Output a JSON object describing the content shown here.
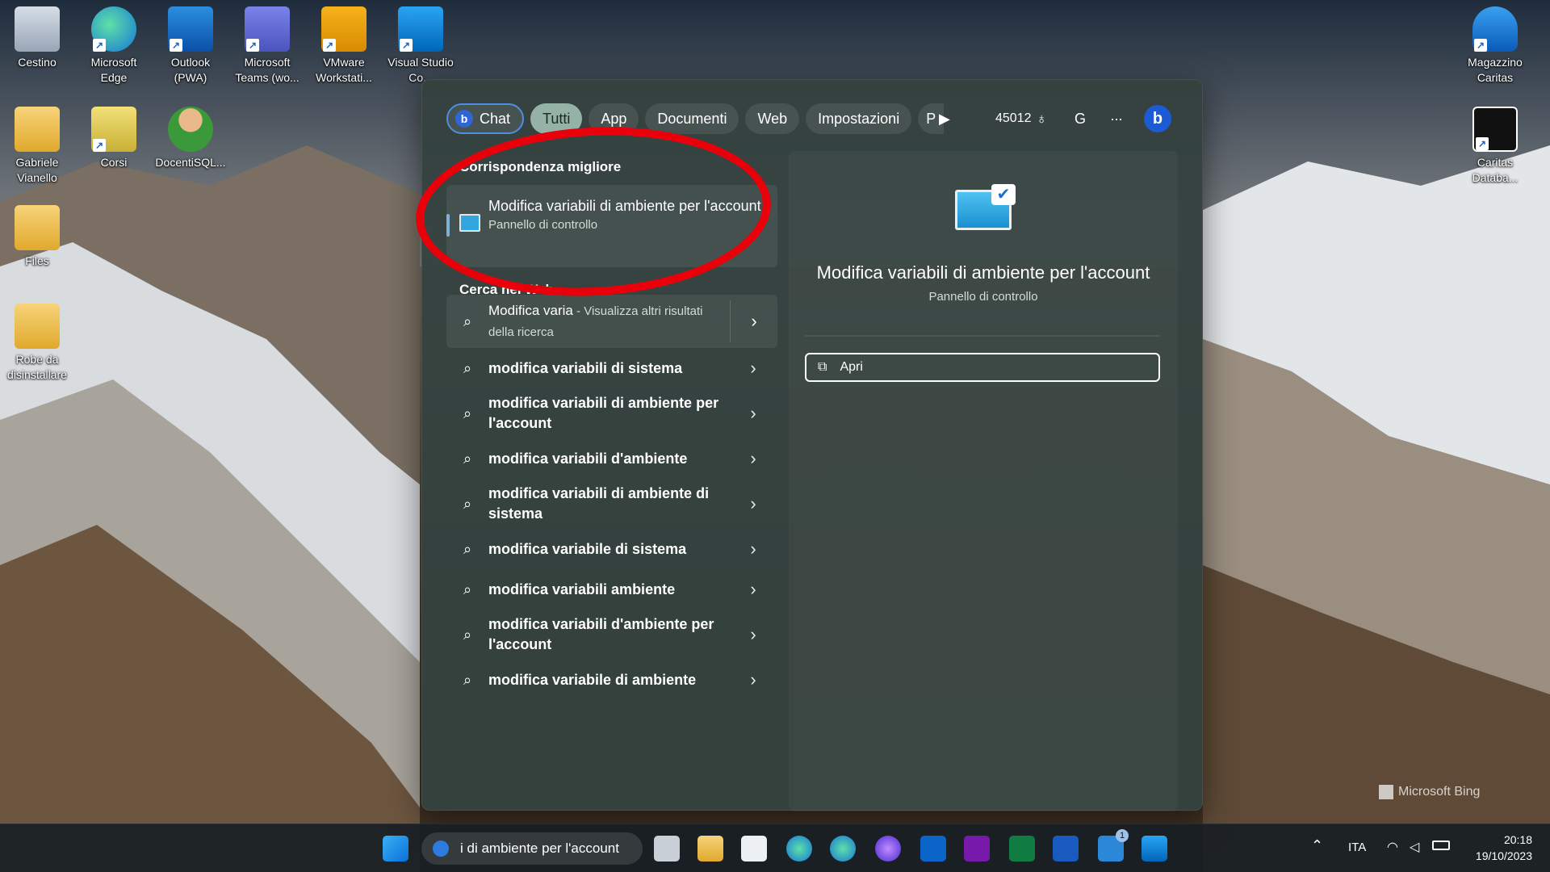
{
  "desktop": {
    "icons_left": [
      {
        "label": "Cestino",
        "icon": "recycle-bin-icon"
      },
      {
        "label": "Microsoft Edge",
        "icon": "edge-icon"
      },
      {
        "label": "Outlook (PWA)",
        "icon": "outlook-icon"
      },
      {
        "label": "Microsoft Teams (wo...",
        "icon": "teams-icon"
      },
      {
        "label": "VMware Workstati...",
        "icon": "vmware-icon"
      },
      {
        "label": "Visual Studio Co...",
        "icon": "vscode-icon"
      },
      {
        "label": "Gabriele Vianello",
        "icon": "user-folder-icon"
      },
      {
        "label": "Corsi",
        "icon": "folder-icon"
      },
      {
        "label": "DocentiSQL...",
        "icon": "sql-user-icon"
      },
      {
        "label": "Files",
        "icon": "folder-icon"
      },
      {
        "label": "Robe da disinstallare",
        "icon": "folder-icon"
      }
    ],
    "icons_right": [
      {
        "label": "Magazzino Caritas",
        "icon": "database-icon"
      },
      {
        "label": "Caritas Databa...",
        "icon": "caritas-hand-icon"
      }
    ],
    "watermark": "Microsoft Bing"
  },
  "search": {
    "tabs": [
      "Chat",
      "Tutti",
      "App",
      "Documenti",
      "Web",
      "Impostazioni",
      "P"
    ],
    "points": "45012",
    "avatar_letter": "G",
    "more": "···",
    "best_match_header": "Corrispondenza migliore",
    "best_match": {
      "title": "Modifica variabili di ambiente per l'account",
      "subtitle": "Pannello di controllo"
    },
    "web_header": "Cerca nel Web",
    "web_first": {
      "title": "Modifica varia",
      "suffix": " - Visualizza altri risultati della ricerca"
    },
    "suggestions": [
      "modifica variabili di sistema",
      "modifica variabili di ambiente per l'account",
      "modifica variabili d'ambiente",
      "modifica variabili di ambiente di sistema",
      "modifica variabile di sistema",
      "modifica variabili ambiente",
      "modifica variabili d'ambiente per l'account",
      "modifica variabile di ambiente"
    ],
    "preview": {
      "title": "Modifica variabili di ambiente per l'account",
      "subtitle": "Pannello di controllo",
      "open_label": "Apri"
    }
  },
  "taskbar": {
    "search_text": "i di ambiente per l'account",
    "language": "ITA",
    "time": "20:18",
    "date": "19/10/2023",
    "badge": "1"
  },
  "colors": {
    "accent": "#4d8fe5",
    "panel": "#34423e",
    "annotation": "#e8000a"
  }
}
